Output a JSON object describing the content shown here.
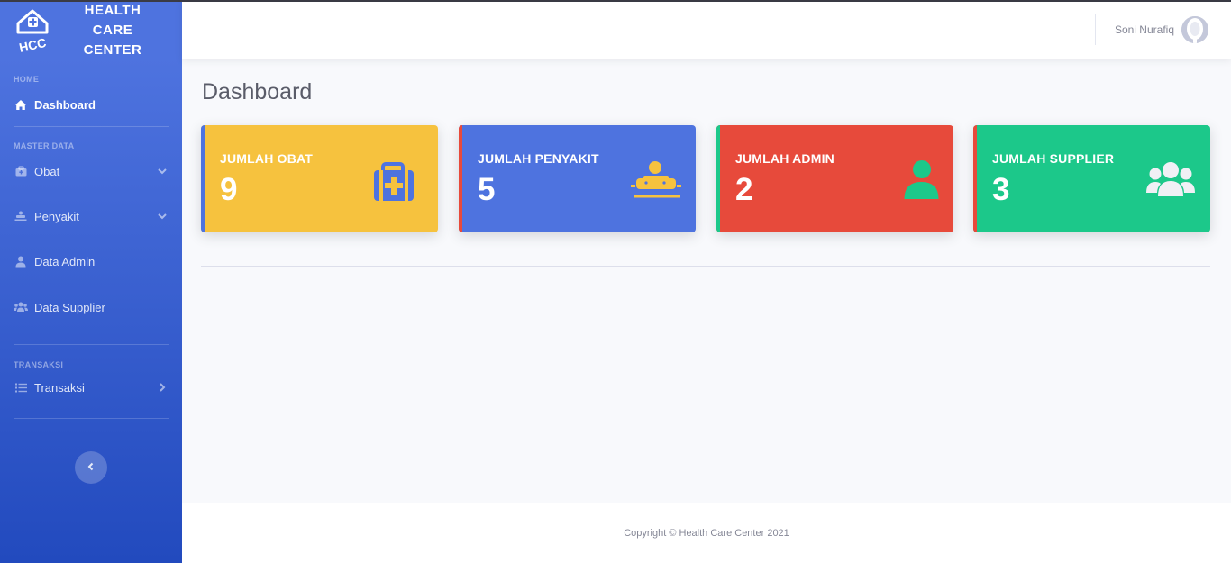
{
  "brand": {
    "logo_text": "HCC",
    "name_line1": "HEALTH CARE",
    "name_line2": "CENTER"
  },
  "sidebar": {
    "headings": {
      "home": "HOME",
      "master": "MASTER DATA",
      "transaksi": "TRANSAKSI"
    },
    "items": [
      {
        "label": "Dashboard",
        "icon": "home-icon",
        "active": true
      },
      {
        "label": "Obat",
        "icon": "medkit-icon",
        "chevron": "down"
      },
      {
        "label": "Penyakit",
        "icon": "procedures-icon",
        "chevron": "down"
      },
      {
        "label": "Data Admin",
        "icon": "user-icon"
      },
      {
        "label": "Data Supplier",
        "icon": "users-icon"
      },
      {
        "label": "Transaksi",
        "icon": "list-icon",
        "chevron": "right"
      }
    ]
  },
  "topbar": {
    "user_name": "Soni Nurafiq"
  },
  "main": {
    "title": "Dashboard",
    "cards": [
      {
        "label": "JUMLAH OBAT",
        "value": "9",
        "color": "#f6c23e",
        "accent": "#4e73df",
        "icon": "medkit-icon"
      },
      {
        "label": "JUMLAH PENYAKIT",
        "value": "5",
        "color": "#4e73df",
        "accent": "#e74a3b",
        "icon": "procedures-icon"
      },
      {
        "label": "JUMLAH ADMIN",
        "value": "2",
        "color": "#e74a3b",
        "accent": "#1cc88a",
        "icon": "user-icon"
      },
      {
        "label": "JUMLAH SUPPLIER",
        "value": "3",
        "color": "#1cc88a",
        "accent": "#e74a3b",
        "icon": "users-icon"
      }
    ]
  },
  "footer": {
    "copyright": "Copyright © Health Care Center 2021"
  }
}
